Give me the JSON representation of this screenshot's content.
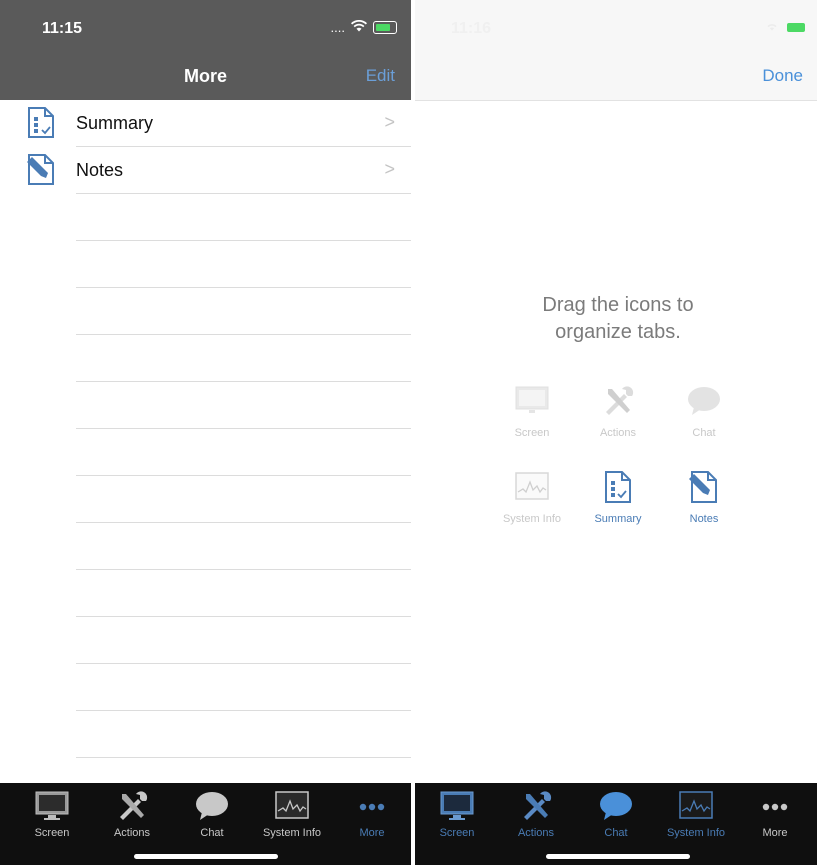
{
  "left": {
    "status": {
      "time": "11:15",
      "signal": "....",
      "wifi": "wifi-icon",
      "battery": "battery-charging-icon"
    },
    "nav": {
      "title": "More",
      "edit": "Edit"
    },
    "rows": [
      {
        "label": "Summary",
        "icon": "summary-icon"
      },
      {
        "label": "Notes",
        "icon": "notes-icon"
      }
    ],
    "tabs": [
      {
        "label": "Screen",
        "icon": "screen-icon"
      },
      {
        "label": "Actions",
        "icon": "actions-icon"
      },
      {
        "label": "Chat",
        "icon": "chat-icon"
      },
      {
        "label": "System Info",
        "icon": "system-info-icon"
      },
      {
        "label": "More",
        "icon": "more-icon",
        "selected": true
      }
    ]
  },
  "right": {
    "status": {
      "time": "11:16"
    },
    "nav": {
      "done": "Done"
    },
    "instruction": "Drag the icons to organize tabs.",
    "grid": [
      {
        "label": "Screen",
        "icon": "screen-icon"
      },
      {
        "label": "Actions",
        "icon": "actions-icon"
      },
      {
        "label": "Chat",
        "icon": "chat-icon"
      },
      {
        "label": "System Info",
        "icon": "system-info-icon"
      },
      {
        "label": "Summary",
        "icon": "summary-icon",
        "active": true
      },
      {
        "label": "Notes",
        "icon": "notes-icon",
        "active": true
      }
    ],
    "tabs": [
      {
        "label": "Screen",
        "icon": "screen-icon",
        "editing": true
      },
      {
        "label": "Actions",
        "icon": "actions-icon",
        "editing": true
      },
      {
        "label": "Chat",
        "icon": "chat-icon",
        "editing": true
      },
      {
        "label": "System Info",
        "icon": "system-info-icon",
        "editing": true
      },
      {
        "label": "More",
        "icon": "more-icon"
      }
    ]
  },
  "colors": {
    "accent": "#4a90d9",
    "header_dark": "#5a5a5a",
    "tabbar": "#0f0f0f"
  }
}
